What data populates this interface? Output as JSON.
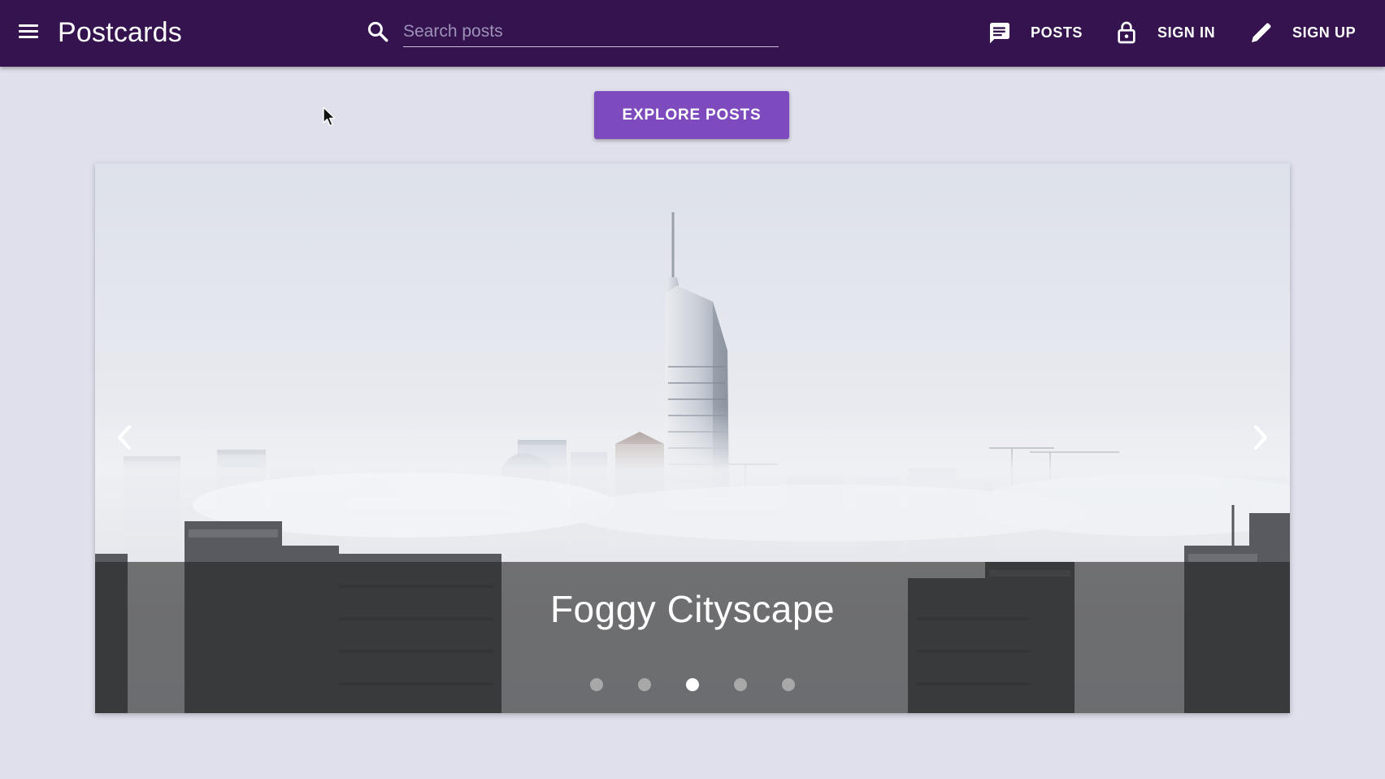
{
  "app": {
    "title": "Postcards"
  },
  "search": {
    "placeholder": "Search posts"
  },
  "nav": {
    "posts_label": "POSTS",
    "signin_label": "SIGN IN",
    "signup_label": "SIGN UP",
    "posts_icon": "message-icon",
    "signin_icon": "lock-icon",
    "signup_icon": "pencil-icon"
  },
  "explore": {
    "label": "EXPLORE POSTS"
  },
  "carousel": {
    "title": "Foggy Cityscape",
    "slide_count": 5,
    "active_index": 2
  },
  "colors": {
    "appbar": "#35134f",
    "accent": "#7d4bbd",
    "background": "#dfe0ec"
  }
}
